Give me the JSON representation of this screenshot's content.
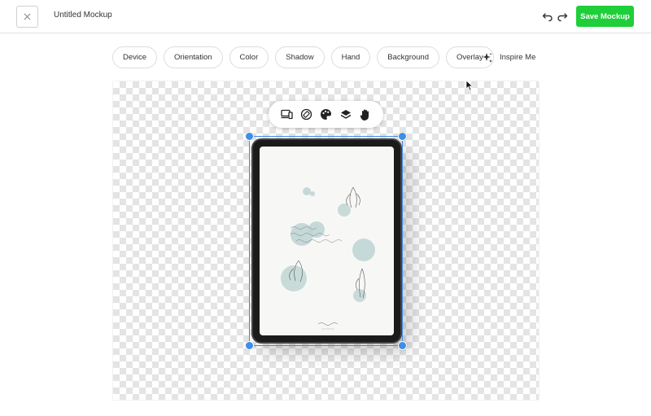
{
  "header": {
    "close_icon": "close-icon",
    "title": "Untitled Mockup",
    "undo_icon": "undo-icon",
    "redo_icon": "redo-icon",
    "save_label": "Save Mockup",
    "save_color": "#1fcf3a"
  },
  "options": {
    "items": [
      {
        "label": "Device"
      },
      {
        "label": "Orientation"
      },
      {
        "label": "Color"
      },
      {
        "label": "Shadow"
      },
      {
        "label": "Hand"
      },
      {
        "label": "Background"
      },
      {
        "label": "Overlay"
      }
    ],
    "inspire_label": "Inspire Me",
    "inspire_icon": "sparkle-icon"
  },
  "floating_toolbar": {
    "tools": [
      "device-icon",
      "rotate-icon",
      "palette-icon",
      "layers-icon",
      "hand-icon"
    ]
  },
  "canvas": {
    "background": "transparent-checkerboard",
    "selection_color": "#3f8ee6",
    "device_type": "tablet"
  }
}
